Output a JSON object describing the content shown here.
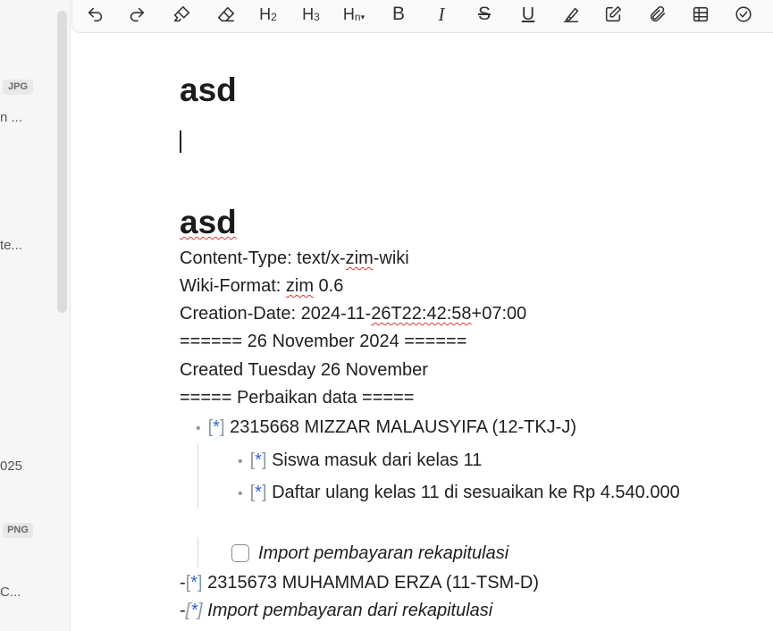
{
  "sidebar": {
    "badge_jpg": "JPG",
    "item1_snippet": "n ...",
    "item2_snippet": "te...",
    "item3_snippet": "025",
    "badge_png": "PNG",
    "item4_snippet": "C..."
  },
  "toolbar": {
    "h2": "H",
    "h2_sub": "2",
    "h3": "H",
    "h3_sub": "3",
    "hn": "H",
    "hn_sub": "n",
    "bold": "B",
    "italic": "I",
    "strike": "S",
    "underline": "U",
    "icons": [
      "undo-icon",
      "redo-icon",
      "format-brush-icon",
      "eraser-icon",
      "h2-icon",
      "h3-icon",
      "hn-icon",
      "bold-icon",
      "italic-icon",
      "strikethrough-icon",
      "underline-icon",
      "highlighter-icon",
      "edit-icon",
      "attachment-icon",
      "table-icon",
      "check-circle-icon"
    ]
  },
  "document": {
    "title": "asd",
    "heading2": "asd",
    "lines": {
      "content_type_prefix": "Content-Type: text/x-",
      "content_type_zim": "zim",
      "content_type_suffix": "-wiki",
      "wiki_format_prefix": "Wiki-Format: ",
      "wiki_format_zim": "zim",
      "wiki_format_suffix": " 0.6",
      "creation_prefix": "Creation-Date: 2024-11-",
      "creation_squig": "26T22:42:58",
      "creation_suffix": "+07:00",
      "date_heading": "====== 26 November 2024 ======",
      "created": "Created Tuesday 26 November",
      "perbaikan": "===== Perbaikan data ====="
    },
    "bracket_open": "[",
    "bracket_star": "*",
    "bracket_close": "]",
    "dash": "-",
    "item1": "2315668 MIZZAR MALAUSYIFA (12-TKJ-J)",
    "sub1": "Siswa masuk dari kelas 11",
    "sub2": "Daftar ulang kelas 11 di sesuaikan ke Rp 4.540.000",
    "todo1": "Import pembayaran rekapitulasi",
    "item2": "2315673 MUHAMMAD ERZA (11-TSM-D)",
    "item3": "Import pembayaran dari rekapitulasi"
  }
}
